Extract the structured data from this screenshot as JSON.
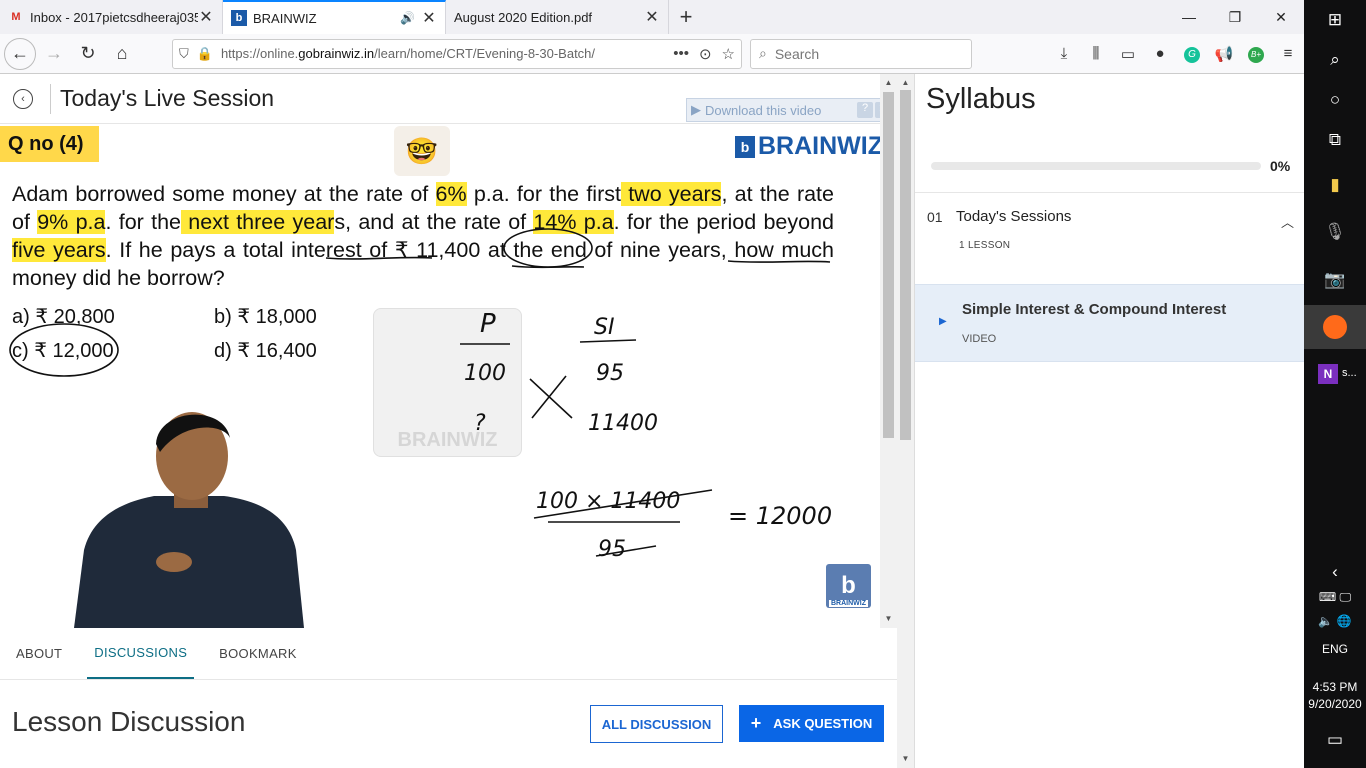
{
  "browser": {
    "tabs": [
      {
        "title": "Inbox - 2017pietcsdheeraj035@",
        "icon": "gmail-icon"
      },
      {
        "title": "BRAINWIZ",
        "icon": "brainwiz-icon",
        "active": true
      },
      {
        "title": "August 2020 Edition.pdf",
        "icon": "pdf-icon"
      }
    ],
    "url_prefix": "https://online.",
    "url_domain": "gobrainwiz.in",
    "url_path": "/learn/home/CRT/Evening-8-30-Batch/",
    "search_placeholder": "Search"
  },
  "session": {
    "title": "Today's Live Session",
    "download_label": "Download this video"
  },
  "video": {
    "qno": "Q no (4)",
    "logo": "BRAINWIZ",
    "question_parts": [
      "Adam borrowed some money at the rate of ",
      "6%",
      " p.a. for the first",
      " two years",
      ", at the rate of ",
      "9% p.a",
      ". for the",
      " next three year",
      "s, and at the rate of ",
      "14% p.a",
      ". for the period beyond ",
      "five years",
      ". If he pays a total interest of ₹ 11,400 at the end of nine years, how much money did he borrow?"
    ],
    "options": [
      {
        "label": "a) ₹ 20,800"
      },
      {
        "label": "b) ₹ 18,000"
      },
      {
        "label": "c) ₹ 12,000"
      },
      {
        "label": "d) ₹ 16,400"
      }
    ],
    "watermark": "BRAINWIZ",
    "handwriting": {
      "p": "P",
      "si": "SI",
      "h100": "100",
      "h95": "95",
      "h7": "?",
      "h11400": "11400",
      "frac_top": "100 × 11400",
      "frac_bottom": "95",
      "result": "= 12000"
    }
  },
  "lesson_tabs": [
    "ABOUT",
    "DISCUSSIONS",
    "BOOKMARK"
  ],
  "discussion": {
    "title": "Lesson Discussion",
    "all_label": "ALL DISCUSSION",
    "ask_label": "ASK QUESTION"
  },
  "syllabus": {
    "title": "Syllabus",
    "progress": 0,
    "progress_label": "0%",
    "section_num": "01",
    "section_name": "Today's Sessions",
    "section_count": "1 LESSON",
    "lesson_title": "Simple Interest & Compound Interest",
    "lesson_type": "VIDEO"
  },
  "taskbar": {
    "onenote_label": "s...",
    "lang": "ENG",
    "time": "4:53 PM",
    "date": "9/20/2020"
  },
  "colors": {
    "accent": "#0a66e6",
    "highlight": "#ffe83a",
    "qno_bg": "#ffd84a",
    "active_tab": "#0d6e85",
    "brand": "#1b5aa8"
  }
}
